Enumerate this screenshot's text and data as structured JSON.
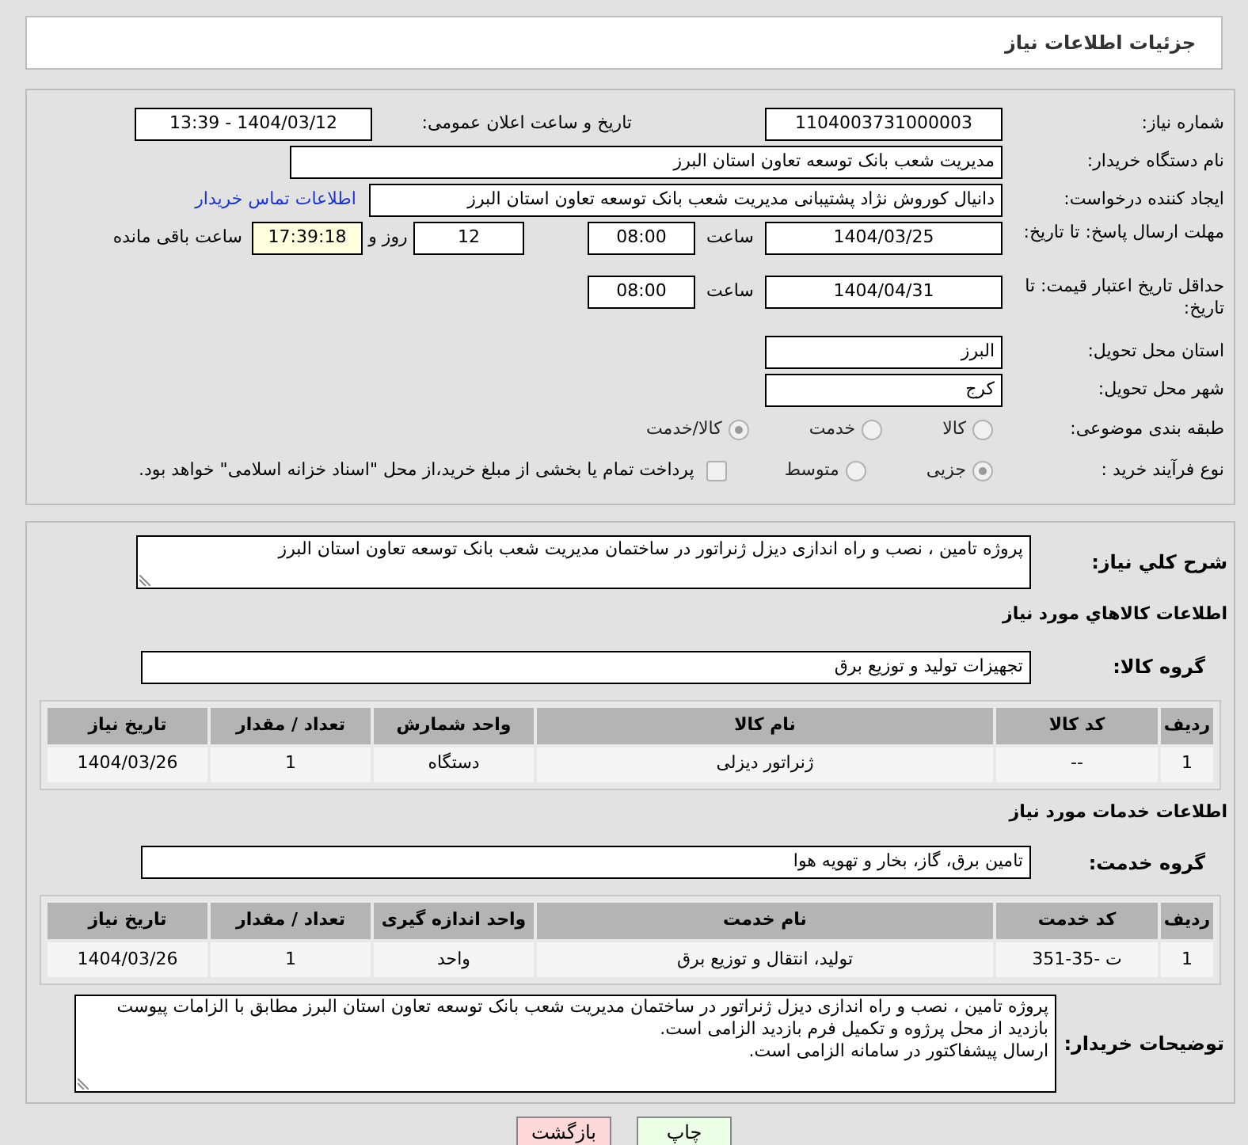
{
  "title": "جزئیات اطلاعات نیاز",
  "need_number": {
    "label": "شماره نیاز:",
    "value": "1104003731000003"
  },
  "announce": {
    "label": "تاریخ و ساعت اعلان عمومی:",
    "value": "1404/03/12 - 13:39"
  },
  "buyer_org": {
    "label": "نام دستگاه خریدار:",
    "value": "مدیریت شعب بانک توسعه تعاون استان البرز"
  },
  "requester": {
    "label": "ایجاد کننده درخواست:",
    "value": "دانیال کوروش نژاد پشتیبانی مدیریت شعب بانک توسعه تعاون استان البرز",
    "link": "اطلاعات تماس خریدار"
  },
  "reply_deadline": {
    "label": "مهلت ارسال پاسخ: تا تاریخ:",
    "date": "1404/03/25",
    "time_label": "ساعت",
    "time": "08:00",
    "days": "12",
    "days_label": "روز و",
    "remaining": "17:39:18",
    "remaining_label": "ساعت باقی مانده"
  },
  "price_validity": {
    "label": "حداقل تاریخ اعتبار قیمت: تا تاریخ:",
    "date": "1404/04/31",
    "time_label": "ساعت",
    "time": "08:00"
  },
  "province": {
    "label": "استان محل تحویل:",
    "value": "البرز"
  },
  "city": {
    "label": "شهر محل تحویل:",
    "value": "کرج"
  },
  "category": {
    "label": "طبقه بندی موضوعی:",
    "options": [
      {
        "label": "کالا",
        "selected": false
      },
      {
        "label": "خدمت",
        "selected": false
      },
      {
        "label": "کالا/خدمت",
        "selected": true
      }
    ]
  },
  "purchase_type": {
    "label": "نوع فرآیند خرید :",
    "options": [
      {
        "label": "جزیی",
        "selected": true
      },
      {
        "label": "متوسط",
        "selected": false
      }
    ],
    "payment_note": {
      "checked": false,
      "text": "پرداخت تمام یا بخشی از مبلغ خرید،از محل \"اسناد خزانه اسلامی\" خواهد بود."
    }
  },
  "summary": {
    "label": "شرح كلي نياز:",
    "value": "پروژه تامین ، نصب و راه اندازی دیزل ژنراتور در ساختمان مدیریت شعب بانک توسعه تعاون استان البرز"
  },
  "goods": {
    "heading": "اطلاعات كالاهاي مورد نياز",
    "group_label": "گروه کالا:",
    "group": "تجهیزات تولید و توزیع برق",
    "columns": [
      "ردیف",
      "کد کالا",
      "نام کالا",
      "واحد شمارش",
      "تعداد / مقدار",
      "تاریخ نیاز"
    ],
    "rows": [
      [
        "1",
        "--",
        "ژنراتور دیزلی",
        "دستگاه",
        "1",
        "1404/03/26"
      ]
    ]
  },
  "services": {
    "heading": "اطلاعات خدمات مورد نياز",
    "group_label": "گروه خدمت:",
    "group": "تامین برق، گاز، بخار و تهویه هوا",
    "columns": [
      "ردیف",
      "کد خدمت",
      "نام خدمت",
      "واحد اندازه گیری",
      "تعداد / مقدار",
      "تاریخ نیاز"
    ],
    "rows": [
      [
        "1",
        "ت -35-351",
        "تولید، انتقال و توزیع برق",
        "واحد",
        "1",
        "1404/03/26"
      ]
    ]
  },
  "buyer_notes": {
    "label": "توضیحات خریدار:",
    "lines": [
      "پروژه تامین ، نصب و راه اندازی دیزل ژنراتور در ساختمان مدیریت شعب بانک توسعه تعاون استان البرز مطابق با الزامات پیوست",
      "بازدید از محل پرژوه و تکمیل فرم بازدید الزامی است.",
      "ارسال پیشفاکتور در سامانه الزامی است."
    ]
  },
  "buttons": [
    {
      "label": "چاپ",
      "kind": "print"
    },
    {
      "label": "بازگشت",
      "kind": "back"
    }
  ]
}
